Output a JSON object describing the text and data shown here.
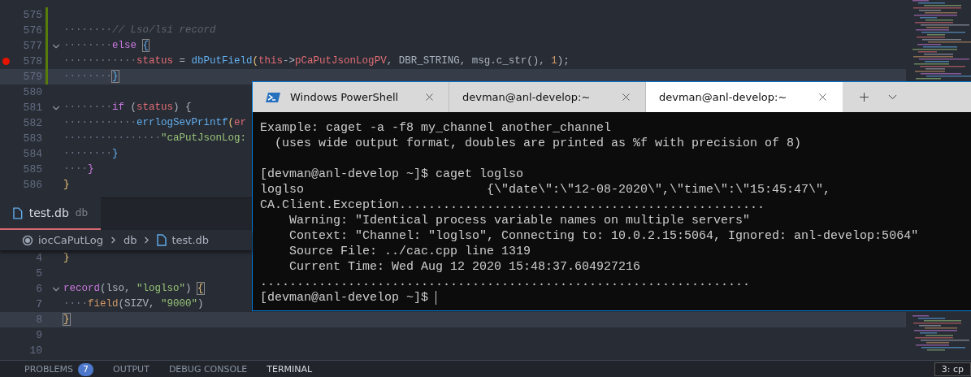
{
  "top_editor": {
    "lines": [
      {
        "number": "575",
        "modified": true,
        "current": false,
        "fold": false,
        "breakpoint": false
      },
      {
        "number": "576",
        "modified": true,
        "current": false,
        "fold": false,
        "breakpoint": false,
        "tokens": [
          {
            "text": "········",
            "kind": "whitespace"
          },
          {
            "text": "// Lso/lsi record",
            "kind": "comment"
          }
        ]
      },
      {
        "number": "577",
        "modified": true,
        "current": false,
        "fold": true,
        "breakpoint": false,
        "tokens": [
          {
            "text": "········",
            "kind": "whitespace"
          },
          {
            "text": "else ",
            "kind": "keyword"
          },
          {
            "text": "{",
            "kind": "brace_blue",
            "matched": true
          }
        ]
      },
      {
        "number": "578",
        "modified": true,
        "current": false,
        "fold": false,
        "breakpoint": true,
        "tokens": [
          {
            "text": "············",
            "kind": "whitespace"
          },
          {
            "text": "status",
            "kind": "variable"
          },
          {
            "text": " = ",
            "kind": "plain"
          },
          {
            "text": "dbPutField",
            "kind": "function"
          },
          {
            "text": "(",
            "kind": "brace_gold"
          },
          {
            "text": "this",
            "kind": "variable"
          },
          {
            "text": "->",
            "kind": "plain"
          },
          {
            "text": "pCaPutJsonLogPV",
            "kind": "variable"
          },
          {
            "text": ", DBR_STRING, msg.c_str(), ",
            "kind": "plain"
          },
          {
            "text": "1",
            "kind": "number"
          },
          {
            "text": ");",
            "kind": "plain"
          }
        ]
      },
      {
        "number": "579",
        "modified": true,
        "current": true,
        "fold": false,
        "breakpoint": false,
        "tokens": [
          {
            "text": "········",
            "kind": "whitespace"
          },
          {
            "text": "}",
            "kind": "brace_blue",
            "matched": true
          }
        ]
      },
      {
        "number": "580",
        "modified": false,
        "current": false,
        "fold": false,
        "breakpoint": false
      },
      {
        "number": "581",
        "modified": false,
        "current": false,
        "fold": true,
        "breakpoint": false,
        "tokens": [
          {
            "text": "········",
            "kind": "whitespace"
          },
          {
            "text": "if",
            "kind": "keyword"
          },
          {
            "text": " (",
            "kind": "plain"
          },
          {
            "text": "status",
            "kind": "variable"
          },
          {
            "text": ") {",
            "kind": "plain"
          }
        ]
      },
      {
        "number": "582",
        "modified": false,
        "current": false,
        "fold": false,
        "breakpoint": false,
        "tokens": [
          {
            "text": "············",
            "kind": "whitespace"
          },
          {
            "text": "errlogSevPrintf",
            "kind": "function"
          },
          {
            "text": "(",
            "kind": "brace_gold"
          },
          {
            "text": "er",
            "kind": "variable"
          }
        ]
      },
      {
        "number": "583",
        "modified": false,
        "current": false,
        "fold": false,
        "breakpoint": false,
        "tokens": [
          {
            "text": "················",
            "kind": "whitespace"
          },
          {
            "text": "\"caPutJsonLog:",
            "kind": "string"
          }
        ]
      },
      {
        "number": "584",
        "modified": false,
        "current": false,
        "fold": false,
        "breakpoint": false,
        "tokens": [
          {
            "text": "········",
            "kind": "whitespace"
          },
          {
            "text": "}",
            "kind": "brace_blue"
          }
        ]
      },
      {
        "number": "585",
        "modified": false,
        "current": false,
        "fold": false,
        "breakpoint": false,
        "tokens": [
          {
            "text": "····",
            "kind": "whitespace"
          },
          {
            "text": "}",
            "kind": "brace_purple"
          }
        ]
      },
      {
        "number": "586",
        "modified": false,
        "current": false,
        "fold": false,
        "breakpoint": false,
        "tokens": [
          {
            "text": "}",
            "kind": "brace_gold"
          }
        ]
      }
    ]
  },
  "bottom_editor": {
    "tab": {
      "title": "test.db",
      "description": "db",
      "selected": true
    },
    "breadcrumbs": [
      {
        "label": "iocCaPutLog",
        "kind": "folder"
      },
      {
        "label": "db",
        "kind": "plain"
      },
      {
        "label": "test.db",
        "kind": "file"
      }
    ],
    "lines": [
      {
        "number": "4",
        "modified": false,
        "current": false,
        "fold": false,
        "breakpoint": false,
        "tokens": [
          {
            "text": "}",
            "kind": "brace_gold"
          }
        ]
      },
      {
        "number": "5",
        "modified": false,
        "current": false,
        "fold": false,
        "breakpoint": false
      },
      {
        "number": "6",
        "modified": false,
        "current": false,
        "fold": true,
        "breakpoint": false,
        "tokens": [
          {
            "text": "record",
            "kind": "keyword"
          },
          {
            "text": "(",
            "kind": "plain"
          },
          {
            "text": "lso, ",
            "kind": "plain"
          },
          {
            "text": "\"loglso\"",
            "kind": "string"
          },
          {
            "text": ") ",
            "kind": "plain"
          },
          {
            "text": "{",
            "kind": "brace_gold",
            "matched": true
          }
        ]
      },
      {
        "number": "7",
        "modified": false,
        "current": false,
        "fold": false,
        "breakpoint": false,
        "tokens": [
          {
            "text": "····",
            "kind": "whitespace"
          },
          {
            "text": "field",
            "kind": "number"
          },
          {
            "text": "(SIZV, ",
            "kind": "plain"
          },
          {
            "text": "\"9000\"",
            "kind": "string"
          },
          {
            "text": ")",
            "kind": "plain"
          }
        ]
      },
      {
        "number": "8",
        "modified": false,
        "current": true,
        "fold": false,
        "breakpoint": false,
        "tokens": [
          {
            "text": "}",
            "kind": "brace_gold",
            "matched": true
          }
        ]
      },
      {
        "number": "9",
        "modified": false,
        "current": false,
        "fold": false,
        "breakpoint": false
      },
      {
        "number": "10",
        "modified": false,
        "current": false,
        "fold": false,
        "breakpoint": false
      }
    ]
  },
  "panel": {
    "tabs": [
      {
        "label": "PROBLEMS",
        "badge": "7",
        "selected": false
      },
      {
        "label": "OUTPUT",
        "selected": false
      },
      {
        "label": "DEBUG CONSOLE",
        "selected": false
      },
      {
        "label": "TERMINAL",
        "selected": true
      }
    ],
    "terminal_selector": "3: cp"
  },
  "terminal_window": {
    "tabs": [
      {
        "title": "Windows PowerShell",
        "kind": "powershell",
        "selected": false
      },
      {
        "title": "devman@anl-develop:~",
        "kind": "shell",
        "selected": false
      },
      {
        "title": "devman@anl-develop:~",
        "kind": "shell",
        "selected": true
      }
    ],
    "lines": [
      {
        "kind": "output",
        "text": "Example: caget -a -f8 my_channel another_channel"
      },
      {
        "kind": "output",
        "text": "  (uses wide output format, doubles are printed as %f with precision of 8)"
      },
      {
        "kind": "blank"
      },
      {
        "kind": "output",
        "text": "[devman@anl-develop ~]$ caget loglso"
      },
      {
        "kind": "output",
        "text": "loglso                         {\\\"date\\\":\\\"12-08-2020\\\",\\\"time\\\":\\\"15:45:47\\\","
      },
      {
        "kind": "output",
        "text": "CA.Client.Exception.................................................."
      },
      {
        "kind": "output",
        "text": "    Warning: \"Identical process variable names on multiple servers\""
      },
      {
        "kind": "output",
        "text": "    Context: \"Channel: \"loglso\", Connecting to: 10.0.2.15:5064, Ignored: anl-develop:5064\""
      },
      {
        "kind": "output",
        "text": "    Source File: ../cac.cpp line 1319"
      },
      {
        "kind": "output",
        "text": "    Current Time: Wed Aug 12 2020 15:48:37.604927216"
      },
      {
        "kind": "output",
        "text": "..................................................................."
      },
      {
        "kind": "prompt",
        "text": "[devman@anl-develop ~]$ "
      }
    ]
  }
}
